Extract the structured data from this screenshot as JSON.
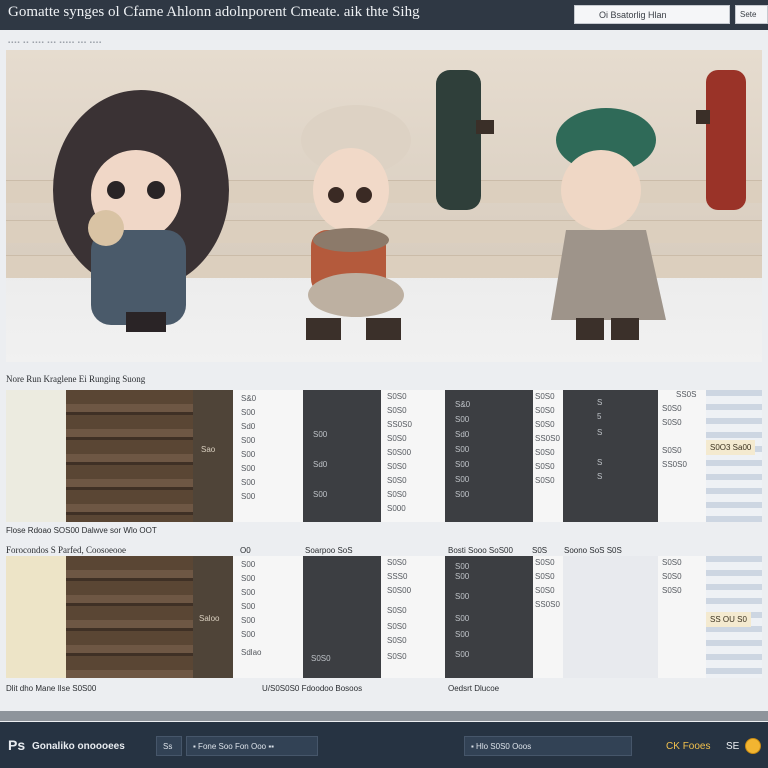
{
  "window": {
    "title": "Gomatte synges ol Cfame Ahlonn adolnporent Cmeate. aik thte Sihg"
  },
  "toolbar": {
    "search_placeholder": "Oi Bsatorlig Hlan",
    "settings_label": "Sete"
  },
  "breadcrumb": "▪▪▪▪ ▪▪ ▪▪▪▪ ▪▪▪ ▪▪▪▪▪ ▪▪▪ ▪▪▪▪",
  "hero": {
    "characters": [
      {
        "name": "dark-haired-character",
        "accent": "#4a5a6a"
      },
      {
        "name": "cream-hat-character",
        "accent": "#b45a3c"
      },
      {
        "name": "green-hat-character",
        "accent": "#2f6a58"
      }
    ],
    "hanging_items": [
      {
        "name": "dark-boot-icon",
        "color": "#2f3f3a"
      },
      {
        "name": "red-boot-icon",
        "color": "#9a3328"
      }
    ]
  },
  "section1": {
    "label": "Nore Run Kraglene Ei Runging Suong",
    "brown_tag": "Sao",
    "numbers_a": [
      "S&0",
      "S00",
      "Sd0",
      "S00",
      "S00",
      "S00",
      "S00",
      "S00"
    ],
    "numbers_b": [
      "S0S0",
      "SS0S0",
      "S0S0",
      "S0S00",
      "S0S0",
      "S0S0",
      "S0S0",
      "S000"
    ],
    "numbers_c": [
      "S0S0",
      "S0S0",
      "S0S0",
      "SS0S0",
      "S0S0",
      "S0S0",
      "S0S0"
    ],
    "right_chip": "S0O3 Sa00",
    "top_numbers": [
      "S0",
      "S0S0",
      "S0S0",
      "S0S0",
      "SS0S"
    ],
    "dark_digits": [
      "S",
      "5",
      "S",
      "S",
      "S"
    ],
    "footer": "Flose Rdoao SOS00 Dalwve sor Wlo OOT"
  },
  "section2": {
    "label": "Forocondos S Parfed, Coosoeooe",
    "top_labels": [
      "O0",
      "Soarpoo SoS",
      "Bosti Sooo SoS00",
      "S0S",
      "Soono SoS S0S"
    ],
    "brown_tag": "Saloo",
    "numbers_a": [
      "S00",
      "S00",
      "S00",
      "S00",
      "S00",
      "S00",
      "Sdlao"
    ],
    "numbers_b": [
      "S0S0",
      "SSS0",
      "S0S00",
      "S0S0",
      "S0S0",
      "S0S0",
      "S0S0"
    ],
    "numbers_c": [
      "S0S0",
      "S0S0",
      "S0S0",
      "SS0S0"
    ],
    "right_chip": "SS OU S0",
    "footer_left": "Dlit dho Mane Ilse S0S00",
    "footer_mid": "U/S0S0S0 Fdoodoo Bosoos",
    "footer_right": "Oedsrt Dlucoe"
  },
  "taskbar": {
    "logo": "Ps",
    "app_name": "Gonaliko onoooees",
    "pill_1": "Ss",
    "pill_2": "▪ Fone Soo Fon Ooo ▪▪",
    "pill_3": "▪ Hlo S0S0 Ooos",
    "coins_label": "Fooes",
    "coins_prefix": "CK",
    "count": "SE"
  }
}
